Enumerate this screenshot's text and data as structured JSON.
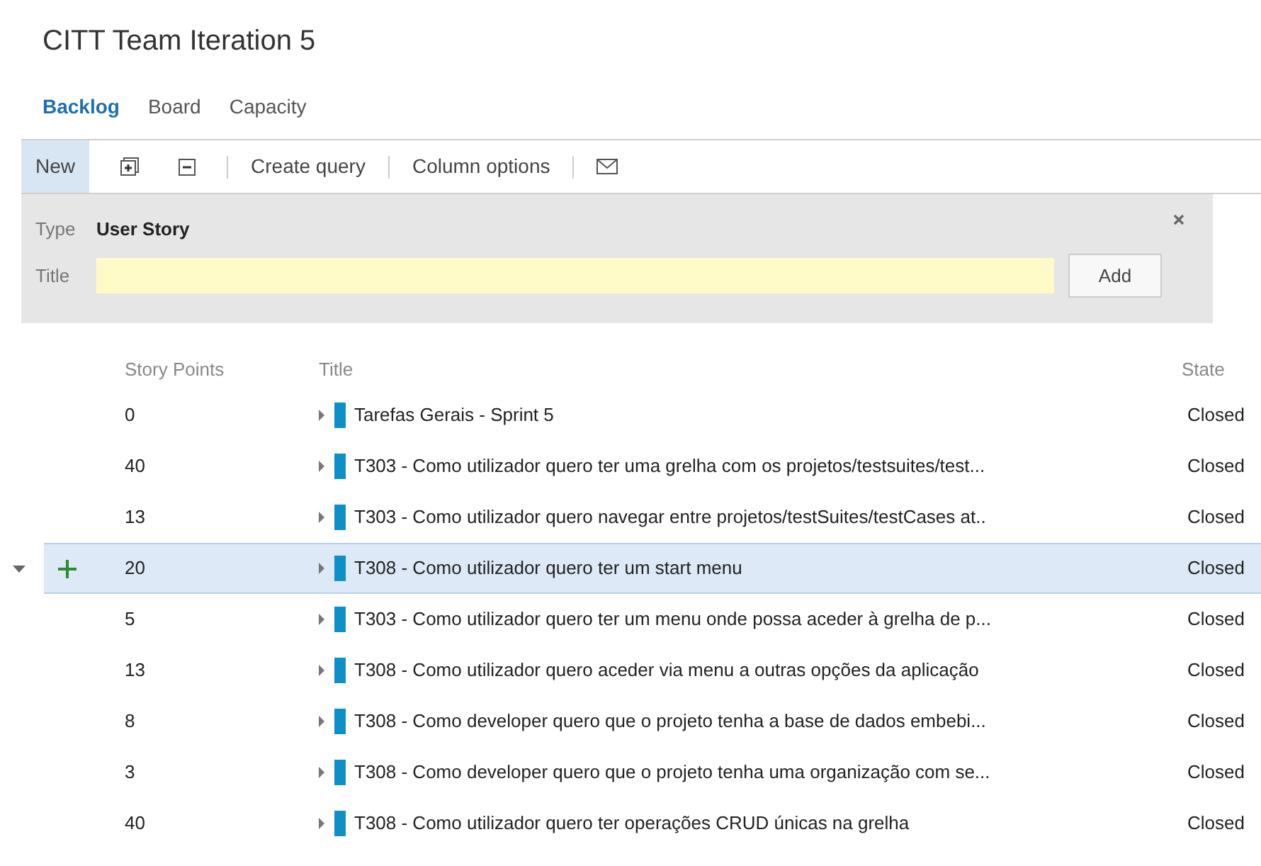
{
  "page_title": "CITT Team Iteration 5",
  "tabs": [
    {
      "label": "Backlog",
      "selected": true
    },
    {
      "label": "Board",
      "selected": false
    },
    {
      "label": "Capacity",
      "selected": false
    }
  ],
  "toolbar": {
    "new_label": "New",
    "create_query": "Create query",
    "column_options": "Column options"
  },
  "new_item_form": {
    "type_label": "Type",
    "type_value": "User Story",
    "title_label": "Title",
    "add_button": "Add"
  },
  "table": {
    "columns": [
      "Story Points",
      "Title",
      "State"
    ],
    "rows": [
      {
        "points": "0",
        "title": "Tarefas Gerais - Sprint 5",
        "state": "Closed",
        "selected": false
      },
      {
        "points": "40",
        "title": "T303 - Como utilizador quero ter uma grelha com os projetos/testsuites/test...",
        "state": "Closed",
        "selected": false
      },
      {
        "points": "13",
        "title": "T303 - Como utilizador quero navegar entre projetos/testSuites/testCases at..",
        "state": "Closed",
        "selected": false
      },
      {
        "points": "20",
        "title": "T308 - Como utilizador quero ter um start menu",
        "state": "Closed",
        "selected": true
      },
      {
        "points": "5",
        "title": "T303 - Como utilizador quero ter um menu onde possa aceder à grelha de p...",
        "state": "Closed",
        "selected": false
      },
      {
        "points": "13",
        "title": "T308 - Como utilizador quero aceder via menu a outras opções da aplicação",
        "state": "Closed",
        "selected": false
      },
      {
        "points": "8",
        "title": "T308 - Como developer quero que o projeto tenha a base de dados embebi...",
        "state": "Closed",
        "selected": false
      },
      {
        "points": "3",
        "title": "T308 - Como developer quero que o projeto tenha uma organização com se...",
        "state": "Closed",
        "selected": false
      },
      {
        "points": "40",
        "title": "T308 - Como utilizador quero ter operações CRUD únicas na grelha",
        "state": "Closed",
        "selected": false
      }
    ]
  }
}
